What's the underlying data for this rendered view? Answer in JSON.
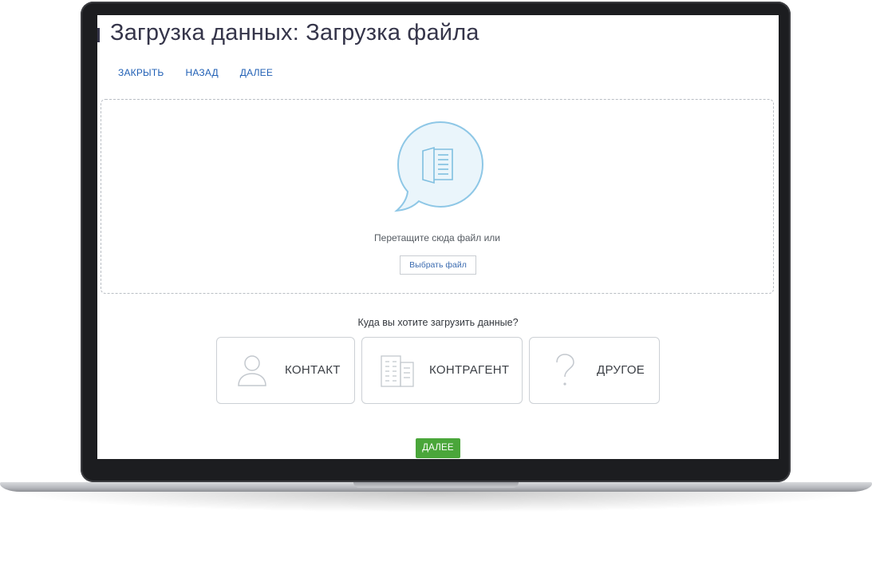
{
  "page": {
    "title": "Загрузка данных: Загрузка файла"
  },
  "nav": {
    "close_label": "ЗАКРЫТЬ",
    "back_label": "НАЗАД",
    "next_label": "ДАЛЕЕ"
  },
  "dropzone": {
    "prompt": "Перетащите сюда файл или",
    "choose_file_label": "Выбрать файл",
    "icon": "file-bubble-icon"
  },
  "destination": {
    "question": "Куда вы хотите загрузить данные?",
    "options": [
      {
        "label": "КОНТАКТ",
        "icon": "person-icon"
      },
      {
        "label": "КОНТРАГЕНТ",
        "icon": "building-icon"
      },
      {
        "label": "ДРУГОЕ",
        "icon": "question-icon"
      }
    ]
  },
  "footer": {
    "next_button_label": "ДАЛЕЕ"
  },
  "colors": {
    "title": "#35354a",
    "link": "#1f5fb5",
    "accent_green": "#4aa63a",
    "bubble_stroke": "#8ec7e6",
    "bubble_fill": "#eaf5fb"
  }
}
